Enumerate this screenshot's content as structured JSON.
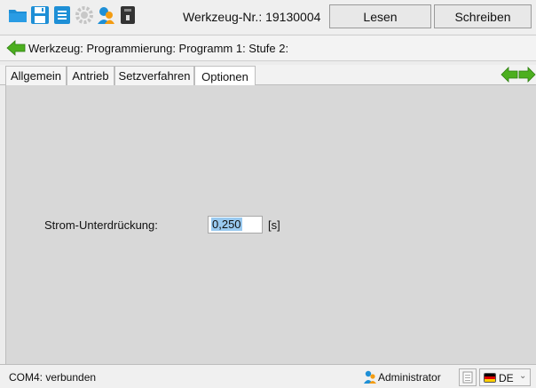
{
  "toolbar": {
    "icons": [
      "folder-icon",
      "save-icon",
      "print-icon",
      "settings-icon",
      "user-icon",
      "usb-device-icon"
    ],
    "tool_number": "Werkzeug-Nr.: 19130004",
    "read_label": "Lesen",
    "write_label": "Schreiben"
  },
  "breadcrumb": {
    "text": "Werkzeug: Programmierung: Programm 1: Stufe 2:"
  },
  "tabs": [
    {
      "label": "Allgemein",
      "active": false
    },
    {
      "label": "Antrieb",
      "active": false
    },
    {
      "label": "Setzverfahren",
      "active": false
    },
    {
      "label": "Optionen",
      "active": true
    }
  ],
  "main": {
    "field": {
      "label": "Strom-Unterdrückung:",
      "value": "0,250",
      "unit": "[s]"
    }
  },
  "status": {
    "connection": "COM4: verbunden",
    "user": "Administrator",
    "language": "DE"
  },
  "colors": {
    "accent_green": "#4caf1f",
    "panel_bg": "#d8d8d8",
    "selection": "#99c9ef",
    "icon_blue": "#1e8fd6"
  }
}
